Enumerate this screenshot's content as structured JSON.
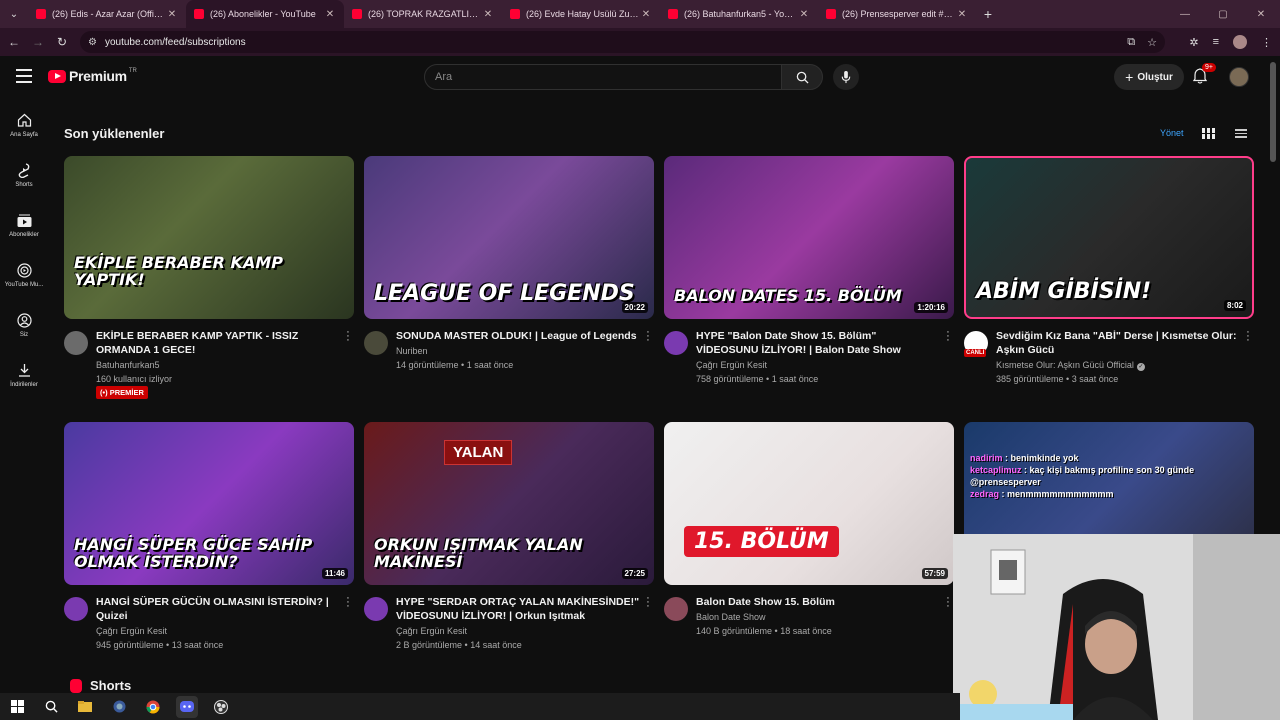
{
  "browser": {
    "tabs": [
      {
        "title": "(26) Edis - Azar Azar (Official Vi",
        "active": false
      },
      {
        "title": "(26) Abonelikler - YouTube",
        "active": true
      },
      {
        "title": "(26) TOPRAK RAZGATLIOĞLU F",
        "active": false
      },
      {
        "title": "(26) Evde Hatay Usülü Zurna Et",
        "active": false
      },
      {
        "title": "(26) Batuhanfurkan5 - YouTube",
        "active": false
      },
      {
        "title": "(26) Prensesperver edit #14 - Y",
        "active": false
      }
    ],
    "url": "youtube.com/feed/subscriptions"
  },
  "header": {
    "logo": "Premium",
    "logo_country": "TR",
    "search_placeholder": "Ara",
    "create_label": "Oluştur",
    "notif_count": "9+"
  },
  "rail": [
    {
      "label": "Ana Sayfa",
      "icon": "home-icon"
    },
    {
      "label": "Shorts",
      "icon": "shorts-icon"
    },
    {
      "label": "Abonelikler",
      "icon": "subscriptions-icon"
    },
    {
      "label": "YouTube Mu...",
      "icon": "youtube-music-icon"
    },
    {
      "label": "Siz",
      "icon": "you-icon"
    },
    {
      "label": "İndirilenler",
      "icon": "download-icon"
    }
  ],
  "main": {
    "section_title": "Son yüklenenler",
    "manage_label": "Yönet",
    "shorts_label": "Shorts"
  },
  "videos": [
    {
      "title": "EKİPLE BERABER KAMP YAPTIK - ISSIZ ORMANDA 1 GECE!",
      "channel": "Batuhanfurkan5",
      "stats": "160 kullanıcı izliyor",
      "duration": "",
      "premier": "PREMİER",
      "thumb_text": "EKİPLE BERABER KAMP YAPTIK!",
      "bg": "linear-gradient(135deg,#3b4a2a 0%,#5a6b3a 40%,#2a3520 100%)",
      "avatar": "#6b6b6b"
    },
    {
      "title": "SONUDA MASTER OLDUK! | League of Legends",
      "channel": "Nuriben",
      "stats": "14 görüntüleme • 1 saat önce",
      "duration": "20:22",
      "thumb_text": "LEAGUE OF LEGENDS",
      "bg": "linear-gradient(135deg,#4a3a7a 0%,#7a4a9a 45%,#2a2a4a 100%)",
      "avatar": "#4a4a3a"
    },
    {
      "title": "HYPE \"Balon Date Show 15. Bölüm\" VİDEOSUNU İZLİYOR! | Balon Date Show",
      "channel": "Çağrı Ergün Kesit",
      "stats": "758 görüntüleme • 1 saat önce",
      "duration": "1:20:16",
      "thumb_text": "BALON DATES 15. BÖLÜM",
      "bg": "linear-gradient(135deg,#5a2a7a 0%,#9a3aa0 50%,#3a1a4a 100%)",
      "avatar": "#7a3ab0"
    },
    {
      "title": "Sevdiğim Kız Bana \"ABİ\" Derse | Kısmetse Olur: Aşkın Gücü",
      "channel": "Kısmetse Olur: Aşkın Gücü Official",
      "stats": "385 görüntüleme • 3 saat önce",
      "duration": "8:02",
      "thumb_text": "ABİM GİBİSİN!",
      "bg": "linear-gradient(135deg,#1a3a3a 0%,#2a2a2a 50%,#1a1a1a 100%)",
      "avatar": "#ffffff",
      "live_badge": "CANLI",
      "verified": true
    },
    {
      "title": "HANGİ SÜPER GÜCÜN OLMASINI İSTERDİN? | Quizei",
      "channel": "Çağrı Ergün Kesit",
      "stats": "945 görüntüleme • 13 saat önce",
      "duration": "11:46",
      "thumb_text": "HANGİ SÜPER GÜCE SAHİP OLMAK İSTERDİN?",
      "bg": "linear-gradient(135deg,#4a3aa0 0%,#8a3ac0 50%,#3a2a6a 100%)",
      "avatar": "#7a3ab0"
    },
    {
      "title": "HYPE \"SERDAR ORTAÇ YALAN MAKİNESİNDE!\" VİDEOSUNU İZLİYOR! | Orkun Işıtmak",
      "channel": "Çağrı Ergün Kesit",
      "stats": "2 B görüntüleme • 14 saat önce",
      "duration": "27:25",
      "thumb_text": "ORKUN IŞITMAK YALAN MAKİNESİ",
      "bg": "linear-gradient(135deg,#6a1a1a 0%,#4a2a5a 50%,#2a1a3a 100%)",
      "avatar": "#7a3ab0",
      "thumb_tag": "YALAN"
    },
    {
      "title": "Balon Date Show 15. Bölüm",
      "channel": "Balon Date Show",
      "stats": "140 B görüntüleme • 18 saat önce",
      "duration": "57:59",
      "thumb_text": "15. BÖLÜM",
      "bg": "linear-gradient(135deg,#f0f0f0 0%,#e8e0e0 60%,#d0c8c8 100%)",
      "avatar": "#8a4a5a"
    }
  ],
  "chat_overlay": [
    {
      "user": "nadirim",
      "msg": " : benimkinde yok",
      "color": "#ff66ff"
    },
    {
      "user": "ketcaplimuz",
      "msg": " : kaç kişi bakmış profiline son 30 günde @prensesperver",
      "color": "#ff66ff"
    },
    {
      "user": "zedrag",
      "msg": " : menmmmmmmmmmmm",
      "color": "#ff66ff"
    }
  ],
  "colors": {
    "accent": "#ff0033",
    "link": "#3ea6ff",
    "premier": "#cc0000"
  }
}
